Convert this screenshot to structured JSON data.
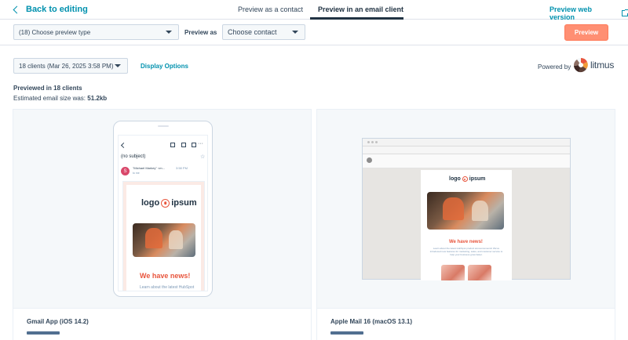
{
  "topnav": {
    "back_label": "Back to editing",
    "tabs": [
      {
        "label": "Preview as a contact",
        "active": false
      },
      {
        "label": "Preview in an email client",
        "active": true
      }
    ],
    "web_version_label": "Preview web version"
  },
  "toolbar": {
    "preview_type_select": "(18) Choose preview type",
    "preview_as_label": "Preview as",
    "contact_select": "Choose contact",
    "preview_button": "Preview"
  },
  "controls": {
    "clients_select": "18 clients (Mar 26, 2025 3:58 PM)",
    "display_options": "Display Options",
    "powered_by": "Powered by",
    "litmus": "litmus"
  },
  "summary": {
    "previewed": "Previewed in 18 clients",
    "estimate_label": "Estimated email size was: ",
    "estimate_value": "51.2kb"
  },
  "colors": {
    "accent": "#0091ae",
    "primary_button": "#ff8f73",
    "brand_orange": "#e8553d",
    "text": "#33475b"
  },
  "cards": [
    {
      "client": "Gmail App (iOS 14.2)",
      "preview": {
        "subject": "(no subject)",
        "avatar_letter": "S",
        "from": "\"Michael Markey\" <m...",
        "time": "3:58 PM",
        "to": "to me",
        "logo_left": "logo",
        "logo_right": "ipsum",
        "headline": "We have news!",
        "body": "Learn about the latest HubSpot"
      }
    },
    {
      "client": "Apple Mail 16 (macOS 13.1)",
      "preview": {
        "logo_left": "logo",
        "logo_right": "ipsum",
        "headline": "We have news!",
        "body": "Learn about the latest HubSpot product announcements! We've introduced new features for marketing, sales, and customer service to help your business grow faster."
      }
    }
  ]
}
